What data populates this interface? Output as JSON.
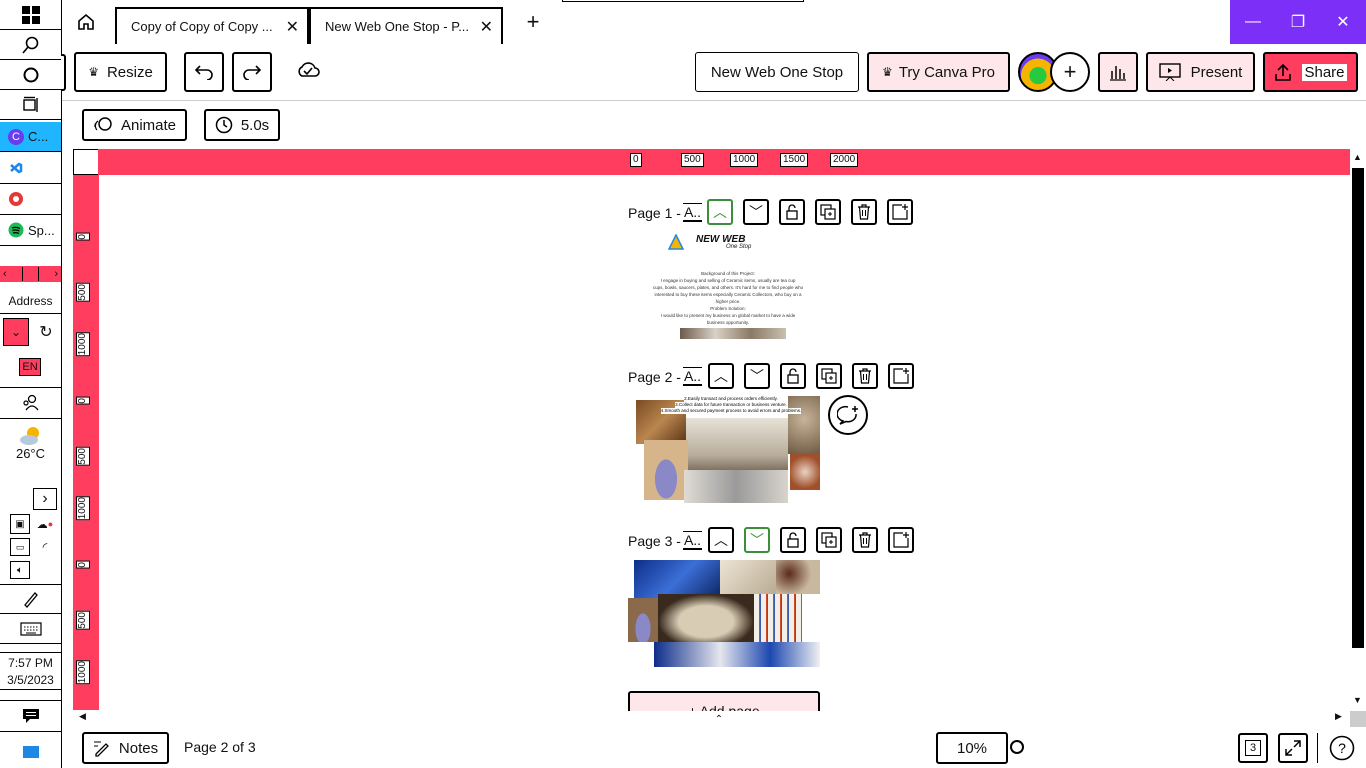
{
  "taskbar": {
    "apps": [
      {
        "label": "C...",
        "icon": "canva-icon"
      },
      {
        "label": "",
        "icon": "vscode-icon"
      },
      {
        "label": "",
        "icon": "chrome-icon"
      },
      {
        "label": "Sp...",
        "icon": "spotify-icon"
      }
    ],
    "address_label": "Address",
    "language": "EN",
    "weather_temp": "26°C",
    "clock_time": "7:57 PM",
    "clock_date": "3/5/2023"
  },
  "tabs": [
    {
      "title": "Copy of Copy of Copy ..."
    },
    {
      "title": "New Web One Stop - P..."
    }
  ],
  "toolbar": {
    "resize_label": "Resize",
    "design_name": "New Web One Stop",
    "try_pro_label": "Try Canva Pro",
    "present_label": "Present",
    "share_label": "Share",
    "animate_label": "Animate",
    "duration_label": "5.0s"
  },
  "ruler": {
    "h_ticks": [
      "0",
      "500",
      "1000",
      "1500",
      "2000"
    ],
    "v_ticks": [
      "0",
      "500",
      "1000"
    ]
  },
  "pages": [
    {
      "label": "Page 1 - ",
      "name": "A..",
      "logo_text": "NEW WEB",
      "logo_sub": "One Stop",
      "body_lines": [
        "Background of this Project:",
        "I engage in buying and selling of Ceramic items, usually are tea cup",
        "cups, bowls, saucers, plates, and others. It's hard for me to find people who",
        "interested to buy these items especially Ceramic Collectors, who buy on a",
        "higher price.",
        "Problem Solution:",
        "I would like to present my business on global market to have a wide",
        "business opportunity."
      ]
    },
    {
      "label": "Page 2 - ",
      "name": "A..",
      "body_lines": [
        "2.Easily transact and process orders efficiently.",
        "3.Collect data for future transaction or business venture.",
        "4.Smooth and secured payment process to avoid errors and problems."
      ]
    },
    {
      "label": "Page 3 - ",
      "name": "A.."
    }
  ],
  "add_page_label": "+ Add page",
  "footer": {
    "notes_label": "Notes",
    "page_indicator": "Page 2 of 3",
    "zoom": "10%",
    "page_count": "3"
  },
  "colors": {
    "accent": "#ff3e5f",
    "window_accent": "#7b2ff7",
    "pink_bg": "#fde7ea"
  }
}
